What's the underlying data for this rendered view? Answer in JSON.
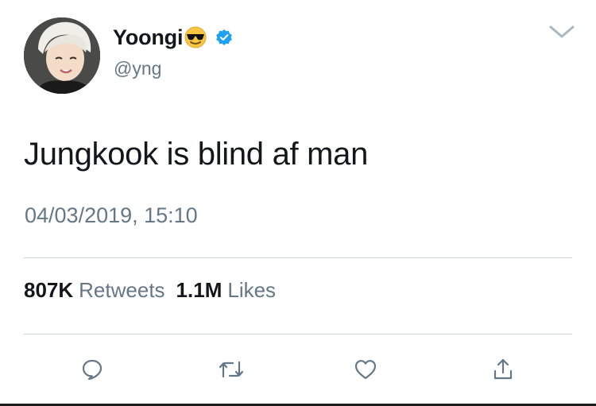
{
  "user": {
    "display_name": "Yoongi",
    "handle": "@yng",
    "name_emoji": "smiling-face-with-sunglasses-icon",
    "verified": true
  },
  "tweet": {
    "text": "Jungkook is blind af man",
    "timestamp": "04/03/2019, 15:10"
  },
  "stats": {
    "retweets_count": "807K",
    "retweets_label": "Retweets",
    "likes_count": "1.1M",
    "likes_label": "Likes"
  },
  "actions": [
    "reply-icon",
    "retweet-icon",
    "like-icon",
    "share-icon"
  ],
  "colors": {
    "text_primary": "#14171a",
    "text_secondary": "#657786",
    "verified_blue": "#1da1f2",
    "icon_gray": "#657786",
    "divider": "#d0d5d9"
  }
}
